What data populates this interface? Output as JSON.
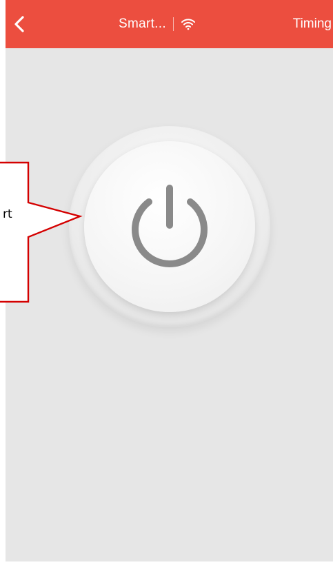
{
  "header": {
    "back_icon": "chevron-left-icon",
    "title": "Smart...",
    "wifi_icon": "wifi-icon",
    "timing_label": "Timing"
  },
  "main": {
    "power_button_icon": "power-icon"
  },
  "annotation": {
    "callout_text": "rt"
  },
  "colors": {
    "header_bg": "#ec4e3f",
    "page_bg": "#e6e6e6",
    "power_icon": "#8a8a8a",
    "callout_border": "#d40000"
  }
}
